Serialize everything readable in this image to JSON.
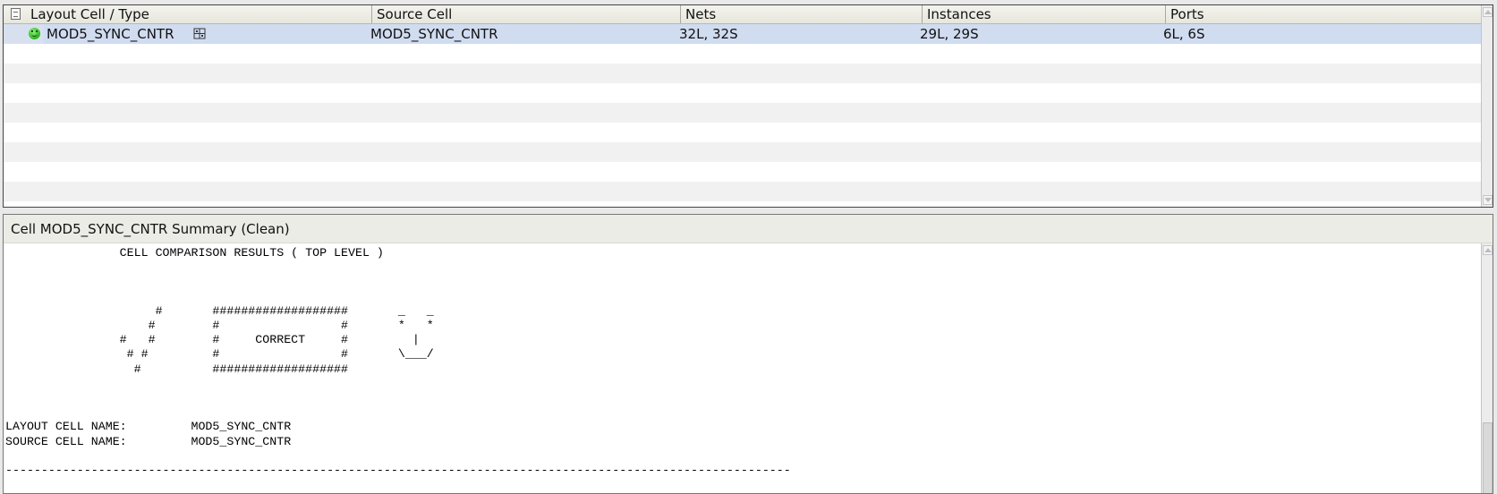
{
  "table": {
    "columns": [
      "Layout Cell / Type",
      "Source Cell",
      "Nets",
      "Instances",
      "Ports"
    ],
    "row": {
      "layout_cell": "MOD5_SYNC_CNTR",
      "source_cell": "MOD5_SYNC_CNTR",
      "nets": "32L, 32S",
      "instances": "29L, 29S",
      "ports": "6L, 6S"
    }
  },
  "summary": {
    "title": "Cell MOD5_SYNC_CNTR Summary (Clean)",
    "report": "                CELL COMPARISON RESULTS ( TOP LEVEL )\n\n\n\n                     #       ###################       _   _\n                    #        #                 #       *   *\n                #   #        #     CORRECT     #         |\n                 # #         #                 #       \\___/\n                  #          ###################\n\n\n\nLAYOUT CELL NAME:         MOD5_SYNC_CNTR\nSOURCE CELL NAME:         MOD5_SYNC_CNTR\n\n--------------------------------------------------------------------------------------------------------------"
  },
  "icons": {
    "header": "cell-list-icon",
    "status": "smiley-correct-icon",
    "hierarchy": "hierarchy-icon"
  },
  "colors": {
    "selected_row": "#d0dcf0",
    "status_green": "#28b41c"
  }
}
